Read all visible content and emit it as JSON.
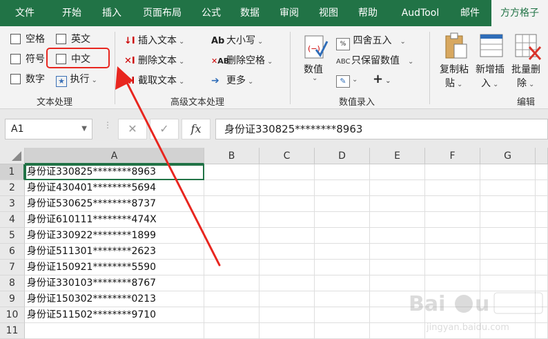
{
  "tabs": [
    "文件",
    "开始",
    "插入",
    "页面布局",
    "公式",
    "数据",
    "审阅",
    "视图",
    "帮助",
    "AudTool",
    "邮件",
    "方方格子"
  ],
  "active_tab": "方方格子",
  "ribbon": {
    "text_processing": {
      "space": "空格",
      "english": "英文",
      "symbol": "符号",
      "chinese": "中文",
      "number": "数字",
      "execute": "执行",
      "group_label": "文本处理"
    },
    "advanced_text": {
      "insert_text": "插入文本",
      "delete_text": "删除文本",
      "extract_text": "截取文本",
      "case": "大小写",
      "delete_spaces": "删除空格",
      "more": "更多",
      "group_label": "高级文本处理"
    },
    "numeric_entry": {
      "value": "数值",
      "round": "四舍五入",
      "keep_values": "只保留数值",
      "group_label": "数值录入"
    },
    "edit": {
      "copy_paste_1": "复制粘",
      "copy_paste_2": "贴",
      "add_insert_1": "新增插",
      "add_insert_2": "入",
      "batch_delete_1": "批量删",
      "batch_delete_2": "除",
      "group_label": "编辑"
    }
  },
  "formula_bar": {
    "name_box": "A1",
    "cancel": "✕",
    "confirm": "✓",
    "fx": "fx",
    "formula": "身份证330825********8963"
  },
  "sheet": {
    "columns": [
      "A",
      "B",
      "C",
      "D",
      "E",
      "F",
      "G"
    ],
    "rows": [
      {
        "num": "1",
        "a": "身份证330825********8963"
      },
      {
        "num": "2",
        "a": "身份证430401********5694"
      },
      {
        "num": "3",
        "a": "身份证530625********8737"
      },
      {
        "num": "4",
        "a": "身份证610111********474X"
      },
      {
        "num": "5",
        "a": "身份证330922********1899"
      },
      {
        "num": "6",
        "a": "身份证511301********2623"
      },
      {
        "num": "7",
        "a": "身份证150921********5590"
      },
      {
        "num": "8",
        "a": "身份证330103********8767"
      },
      {
        "num": "9",
        "a": "身份证150302********0213"
      },
      {
        "num": "10",
        "a": "身份证511502********9710"
      },
      {
        "num": "11",
        "a": ""
      }
    ]
  },
  "watermark": {
    "brand": "Bai du 经验",
    "url": "jingyan.baidu.com"
  },
  "colors": {
    "excel_green": "#217346",
    "annotation_red": "#e8261f"
  }
}
